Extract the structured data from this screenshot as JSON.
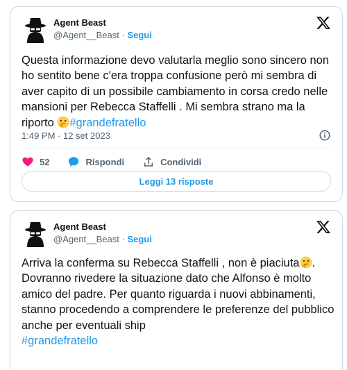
{
  "tweets": [
    {
      "author_name": "Agent Beast",
      "handle": "@Agent__Beast",
      "separator": "·",
      "follow_label": "Segui",
      "text": "Questa informazione devo valutarla meglio sono sincero non ho sentito bene c'era troppa confusione però mi sembra di aver capito di un possibile cambiamento in corsa credo nelle mansioni per Rebecca Staffelli . Mi sembra strano ma la riporto ",
      "emoji": "thinking-face-emoji",
      "hashtag": "#grandefratello",
      "timestamp": "1:49 PM · 12 set 2023",
      "likes": "52",
      "reply_label": "Rispondi",
      "share_label": "Condividi",
      "replies_button": "Leggi 13 risposte"
    },
    {
      "author_name": "Agent Beast",
      "handle": "@Agent__Beast",
      "separator": "·",
      "follow_label": "Segui",
      "text_before_emoji": "Arriva la conferma su Rebecca Staffelli , non è piaciuta",
      "text_after_emoji": ". Dovranno rivedere la situazione dato che Alfonso è molto amico del padre. Per quanto riguarda i nuovi abbinamenti, stanno procedendo  a comprendere le preferenze del pubblico anche per eventuali ship",
      "emoji": "thinking-face-emoji",
      "hashtag": "#grandefratello"
    }
  ],
  "colors": {
    "accent": "#1d9bf0",
    "text": "#0f1419",
    "secondary": "#536471",
    "border": "#cfd9de",
    "heart": "#f91880"
  }
}
